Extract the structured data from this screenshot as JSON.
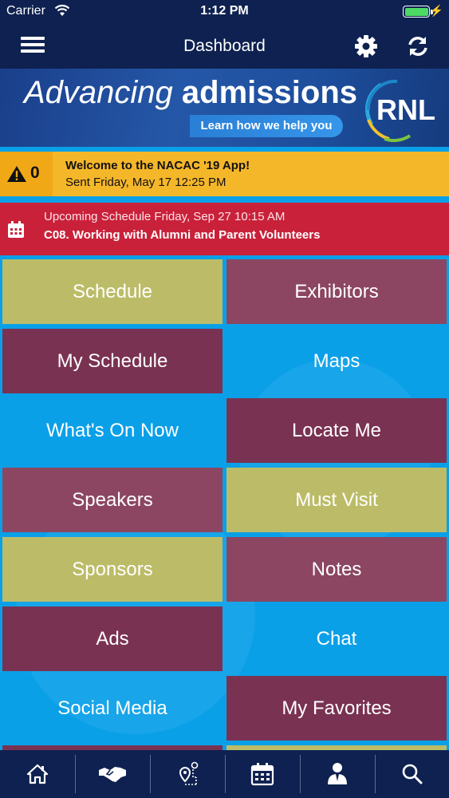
{
  "status_bar": {
    "carrier": "Carrier",
    "time": "1:12 PM",
    "battery_level": 1.0,
    "wifi_icon": "wifi-icon",
    "charging_icon": "bolt-icon"
  },
  "nav": {
    "title": "Dashboard",
    "menu_icon": "hamburger-menu-icon",
    "settings_icon": "gear-icon",
    "refresh_icon": "refresh-icon"
  },
  "ad": {
    "headline_light": "Advancing",
    "headline_bold": "admissions",
    "cta": "Learn how we help you",
    "logo_text": "RNL"
  },
  "alert": {
    "count": "0",
    "title": "Welcome to the NACAC '19 App!",
    "sent": "Sent Friday, May 17 12:25 PM",
    "color": "#f5b72a"
  },
  "upcoming": {
    "line1": "Upcoming Schedule Friday, Sep 27 10:15 AM",
    "line2": "C08. Working with Alumni and Parent Volunteers",
    "color": "#c9213a"
  },
  "tiles": [
    {
      "label": "Schedule",
      "style": "olive"
    },
    {
      "label": "Exhibitors",
      "style": "rose"
    },
    {
      "label": "My Schedule",
      "style": "maroon"
    },
    {
      "label": "Maps",
      "style": "clear"
    },
    {
      "label": "What's On Now",
      "style": "clear"
    },
    {
      "label": "Locate Me",
      "style": "maroon"
    },
    {
      "label": "Speakers",
      "style": "rose"
    },
    {
      "label": "Must Visit",
      "style": "olive"
    },
    {
      "label": "Sponsors",
      "style": "olive"
    },
    {
      "label": "Notes",
      "style": "rose"
    },
    {
      "label": "Ads",
      "style": "maroon"
    },
    {
      "label": "Chat",
      "style": "clear"
    },
    {
      "label": "Social Media",
      "style": "clear"
    },
    {
      "label": "My Favorites",
      "style": "maroon"
    }
  ],
  "tab_bar": [
    {
      "icon": "home-icon"
    },
    {
      "icon": "handshake-icon"
    },
    {
      "icon": "map-route-icon"
    },
    {
      "icon": "calendar-icon"
    },
    {
      "icon": "person-icon"
    },
    {
      "icon": "search-icon"
    }
  ],
  "colors": {
    "navy": "#0e2150",
    "grid_blue": "#0aa0e8",
    "olive": "#bcbc68",
    "rose": "#8c4661",
    "maroon": "#7a3252"
  }
}
